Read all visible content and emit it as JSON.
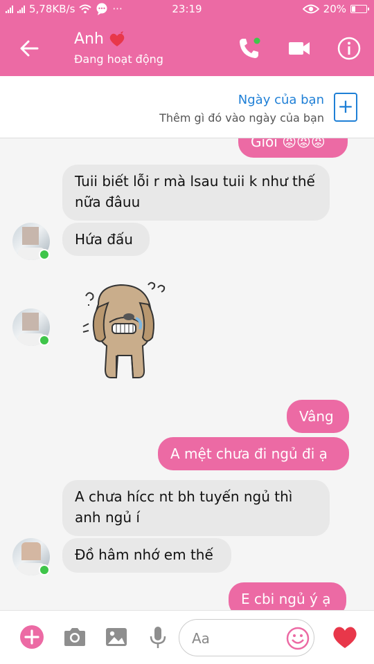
{
  "status_bar": {
    "speed": "5,78KB/s",
    "time": "23:19",
    "battery": "20%",
    "dots": "···"
  },
  "header": {
    "name": "Anh",
    "status": "Đang hoạt động"
  },
  "day_banner": {
    "title": "Ngày của bạn",
    "subtitle": "Thêm gì đó vào ngày của bạn",
    "add": "+"
  },
  "messages": [
    {
      "from": "me",
      "text": "Giỏi 😡😡😡"
    },
    {
      "from": "them",
      "text": "Tuii biết lỗi r mà lsau tuii k như thế nữa đâuu"
    },
    {
      "from": "them",
      "text": "Hứa đấu"
    },
    {
      "from": "them",
      "type": "sticker",
      "text": ""
    },
    {
      "from": "me",
      "text": "Vâng"
    },
    {
      "from": "me",
      "text": "A mệt chưa đi ngủ đi ạ"
    },
    {
      "from": "them",
      "text": "A chưa hícc nt bh tuyến ngủ thì anh ngủ í"
    },
    {
      "from": "them",
      "text": "Đồ hâm nhớ em thế"
    },
    {
      "from": "me",
      "text": "E cbi ngủ ý ạ"
    }
  ],
  "composer": {
    "placeholder": "Aa",
    "add": "+"
  },
  "colors": {
    "accent": "#ec6aa4",
    "link": "#1e7fd6",
    "online": "#3fc54a",
    "incoming_bubble": "#e8e8e8"
  }
}
